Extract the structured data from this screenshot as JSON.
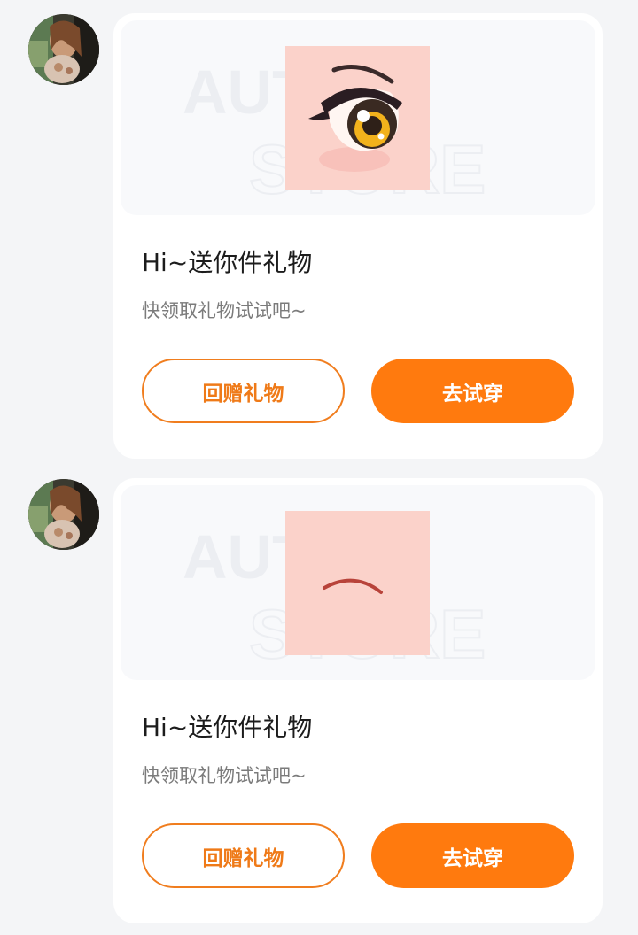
{
  "colors": {
    "accent": "#ff7a0e",
    "accent_outline": "#f07d1e",
    "card_bg": "#ffffff",
    "page_bg": "#f4f5f7",
    "skin_tone": "#fbd2ca"
  },
  "messages": [
    {
      "sender_avatar_icon": "user-avatar-photo",
      "gift_item_icon": "anime-eye-icon",
      "watermark_line1": "AUTAR",
      "watermark_line2": "STORE",
      "title": "Hi~送你件礼物",
      "subtitle": "快领取礼物试试吧~",
      "return_gift_label": "回赠礼物",
      "try_on_label": "去试穿"
    },
    {
      "sender_avatar_icon": "user-avatar-photo",
      "gift_item_icon": "eyebrow-icon",
      "watermark_line1": "AUTAR",
      "watermark_line2": "STORE",
      "title": "Hi~送你件礼物",
      "subtitle": "快领取礼物试试吧~",
      "return_gift_label": "回赠礼物",
      "try_on_label": "去试穿"
    }
  ]
}
